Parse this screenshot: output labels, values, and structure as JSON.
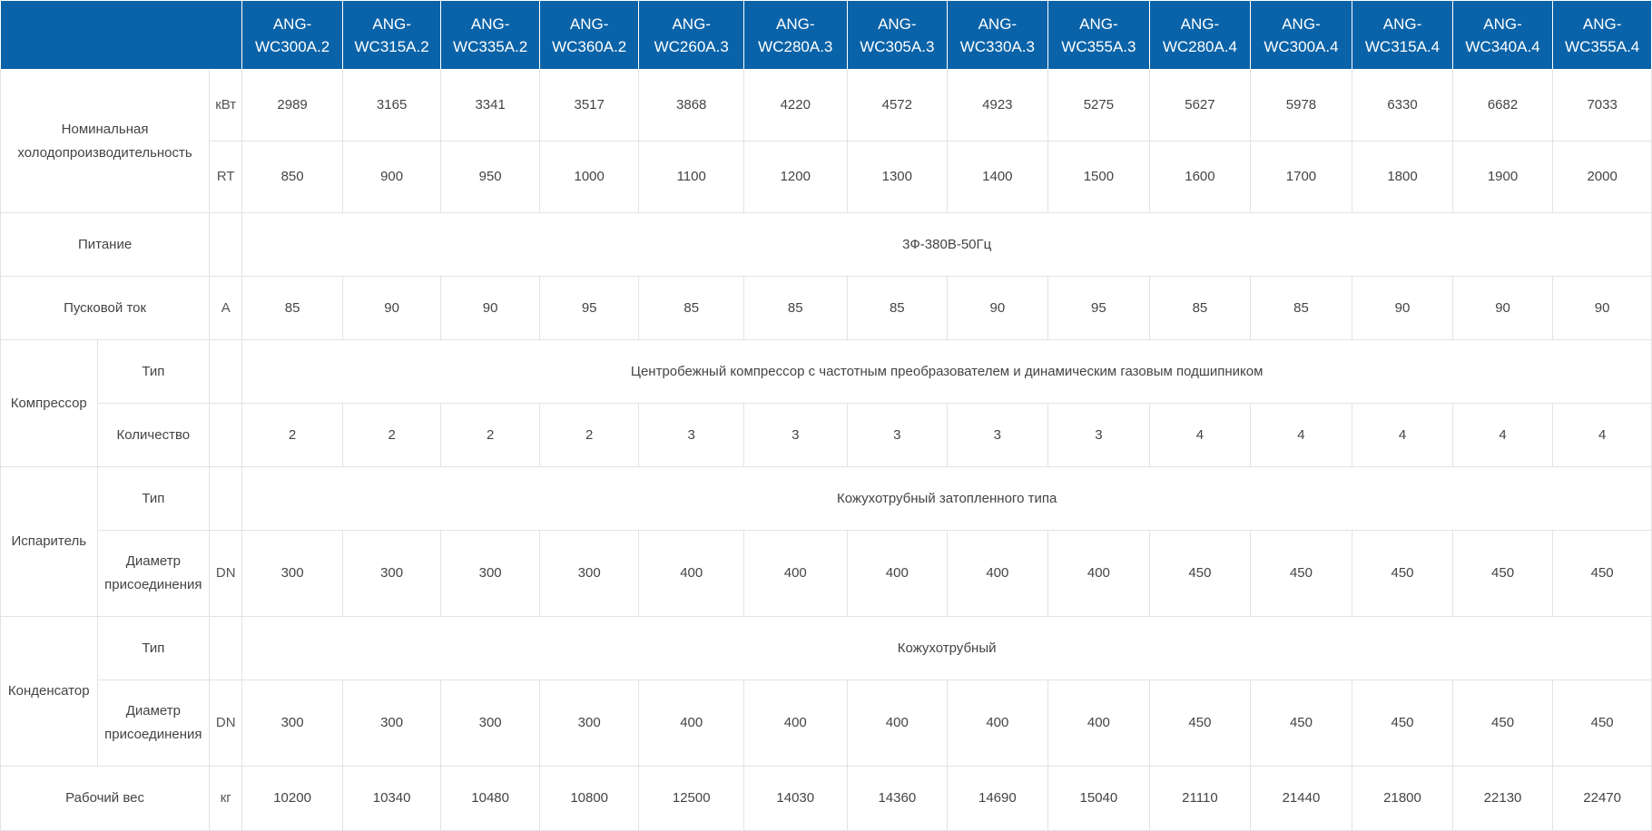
{
  "models": [
    {
      "line1": "ANG-",
      "line2": "WC300A.2"
    },
    {
      "line1": "ANG-",
      "line2": "WC315A.2"
    },
    {
      "line1": "ANG-",
      "line2": "WC335A.2"
    },
    {
      "line1": "ANG-",
      "line2": "WC360A.2"
    },
    {
      "line1": "ANG-",
      "line2": "WC260A.3"
    },
    {
      "line1": "ANG-",
      "line2": "WC280A.3"
    },
    {
      "line1": "ANG-",
      "line2": "WC305A.3"
    },
    {
      "line1": "ANG-",
      "line2": "WC330A.3"
    },
    {
      "line1": "ANG-",
      "line2": "WC355A.3"
    },
    {
      "line1": "ANG-",
      "line2": "WC280A.4"
    },
    {
      "line1": "ANG-",
      "line2": "WC300A.4"
    },
    {
      "line1": "ANG-",
      "line2": "WC315A.4"
    },
    {
      "line1": "ANG-",
      "line2": "WC340A.4"
    },
    {
      "line1": "ANG-",
      "line2": "WC355A.4"
    }
  ],
  "capacity": {
    "label_line1": "Номинальная",
    "label_line2": "холодопроизводительность",
    "kw": {
      "unit": "кВт",
      "values": [
        "2989",
        "3165",
        "3341",
        "3517",
        "3868",
        "4220",
        "4572",
        "4923",
        "5275",
        "5627",
        "5978",
        "6330",
        "6682",
        "7033"
      ]
    },
    "rt": {
      "unit": "RT",
      "values": [
        "850",
        "900",
        "950",
        "1000",
        "1100",
        "1200",
        "1300",
        "1400",
        "1500",
        "1600",
        "1700",
        "1800",
        "1900",
        "2000"
      ]
    }
  },
  "power": {
    "label": "Питание",
    "value": "3Ф-380В-50Гц"
  },
  "start_current": {
    "label": "Пусковой ток",
    "unit": "A",
    "values": [
      "85",
      "90",
      "90",
      "95",
      "85",
      "85",
      "85",
      "90",
      "95",
      "85",
      "85",
      "90",
      "90",
      "90"
    ]
  },
  "compressor": {
    "label": "Компрессор",
    "type_label": "Тип",
    "type_value": "Центробежный компрессор с частотным преобразователем и динамическим газовым подшипником",
    "qty_label": "Количество",
    "qty_values": [
      "2",
      "2",
      "2",
      "2",
      "3",
      "3",
      "3",
      "3",
      "3",
      "4",
      "4",
      "4",
      "4",
      "4"
    ]
  },
  "evaporator": {
    "label": "Испаритель",
    "type_label": "Тип",
    "type_value": "Кожухотрубный затопленного типа",
    "dia_label_line1": "Диаметр",
    "dia_label_line2": "присоединения",
    "dia_unit": "DN",
    "dia_values": [
      "300",
      "300",
      "300",
      "300",
      "400",
      "400",
      "400",
      "400",
      "400",
      "450",
      "450",
      "450",
      "450",
      "450"
    ]
  },
  "condenser": {
    "label": "Конденсатор",
    "type_label": "Тип",
    "type_value": "Кожухотрубный",
    "dia_label_line1": "Диаметр",
    "dia_label_line2": "присоединения",
    "dia_unit": "DN",
    "dia_values": [
      "300",
      "300",
      "300",
      "300",
      "400",
      "400",
      "400",
      "400",
      "400",
      "450",
      "450",
      "450",
      "450",
      "450"
    ]
  },
  "weight": {
    "label": "Рабочий вес",
    "unit": "кг",
    "values": [
      "10200",
      "10340",
      "10480",
      "10800",
      "12500",
      "14030",
      "14360",
      "14690",
      "15040",
      "21110",
      "21440",
      "21800",
      "22130",
      "22470"
    ]
  },
  "colors": {
    "header_bg": "#0a63a8",
    "header_text": "#ffffff",
    "border": "#e3e3e3",
    "text": "#444444"
  }
}
